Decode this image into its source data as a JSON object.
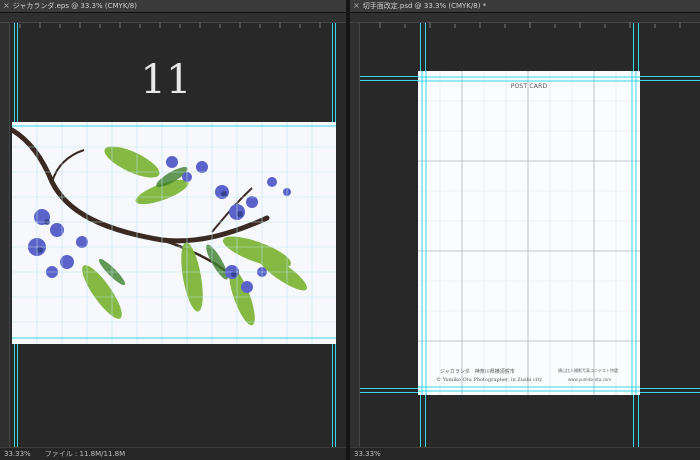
{
  "left_window": {
    "tab_title": "ジャカランダ.eps @ 33.3% (CMYK/8)",
    "big_number": "11",
    "zoom": "33.33%",
    "file_info": "ファイル : 11.8M/11.8M"
  },
  "right_window": {
    "tab_title": "切手面改定.psd @ 33.3% (CMYK/8) *",
    "zoom": "33.33%",
    "card": {
      "title": "POST CARD",
      "caption_line1": "ジャカランダ　神奈川県横須賀市",
      "caption_line2": "© Yumiko Ota Photographer, in Zushi city",
      "caption_right1": "横山比人撮影写真コンテスト特選",
      "caption_right2": "www.yumiko-ota.com"
    }
  },
  "colors": {
    "guide": "#34d6e8",
    "canvas_bg": "#282828"
  },
  "icons": {
    "tab_close": "close-icon"
  }
}
